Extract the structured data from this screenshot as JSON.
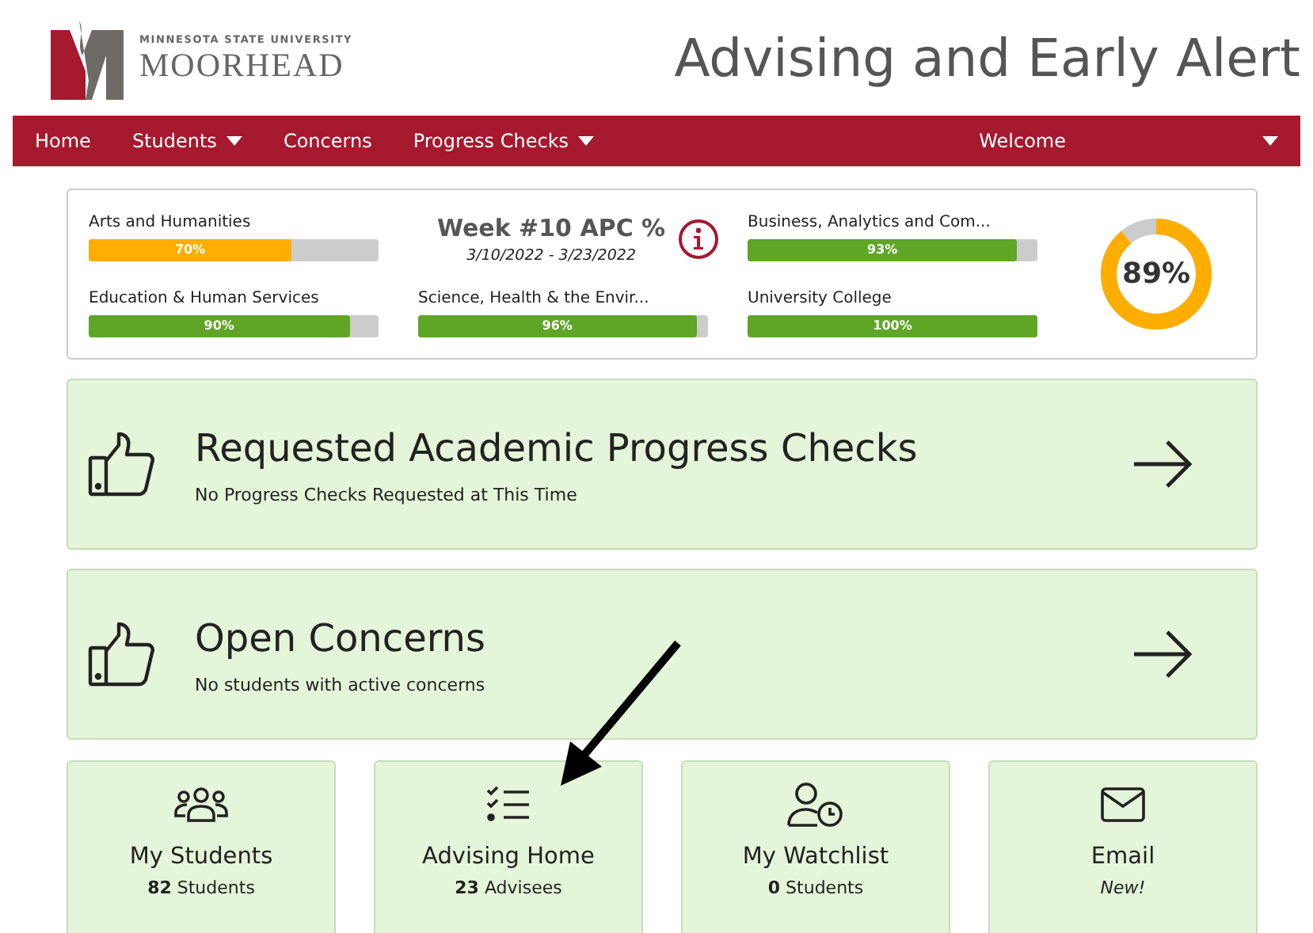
{
  "logo": {
    "small": "MINNESOTA STATE UNIVERSITY",
    "big": "MOORHEAD"
  },
  "app_title": "Advising and Early Alert",
  "nav": [
    {
      "label": "Home",
      "dropdown": false
    },
    {
      "label": "Students",
      "dropdown": true
    },
    {
      "label": "Concerns",
      "dropdown": false
    },
    {
      "label": "Progress Checks",
      "dropdown": true
    }
  ],
  "nav_right": {
    "label": "Welcome",
    "dropdown": true
  },
  "summary": {
    "title": "Week #10 APC %",
    "dates": "3/10/2022 - 3/23/2022",
    "overall": {
      "label": "89%",
      "level": 0.89
    },
    "colleges": [
      {
        "name": "Arts and Humanities",
        "reading": "70%",
        "level": 0.7,
        "color": "#ffae00"
      },
      {
        "name": "Education & Human Services",
        "reading": "90%",
        "level": 0.9,
        "color": "#5fa526"
      },
      {
        "name": "Science, Health & the Envir...",
        "reading": "96%",
        "level": 0.96,
        "color": "#5fa526"
      },
      {
        "name": "Business, Analytics and Com...",
        "reading": "93%",
        "level": 0.93,
        "color": "#5fa526"
      },
      {
        "name": "University College",
        "reading": "100%",
        "level": 1,
        "color": "#5fa526"
      }
    ]
  },
  "panels": [
    {
      "title": "Requested Academic Progress Checks",
      "subtitle": "No Progress Checks Requested at This Time"
    },
    {
      "title": "Open Concerns",
      "subtitle": "No students with active concerns"
    }
  ],
  "tiles": [
    {
      "kind": "people",
      "title": "My Students",
      "count": "82",
      "note": "Students"
    },
    {
      "kind": "checklist",
      "title": "Advising Home",
      "count": "23",
      "note": "Advisees"
    },
    {
      "kind": "watchlist",
      "title": "My Watchlist",
      "count": "0",
      "note": "Students"
    },
    {
      "kind": "email",
      "title": "Email",
      "note_italic": "New!"
    }
  ]
}
